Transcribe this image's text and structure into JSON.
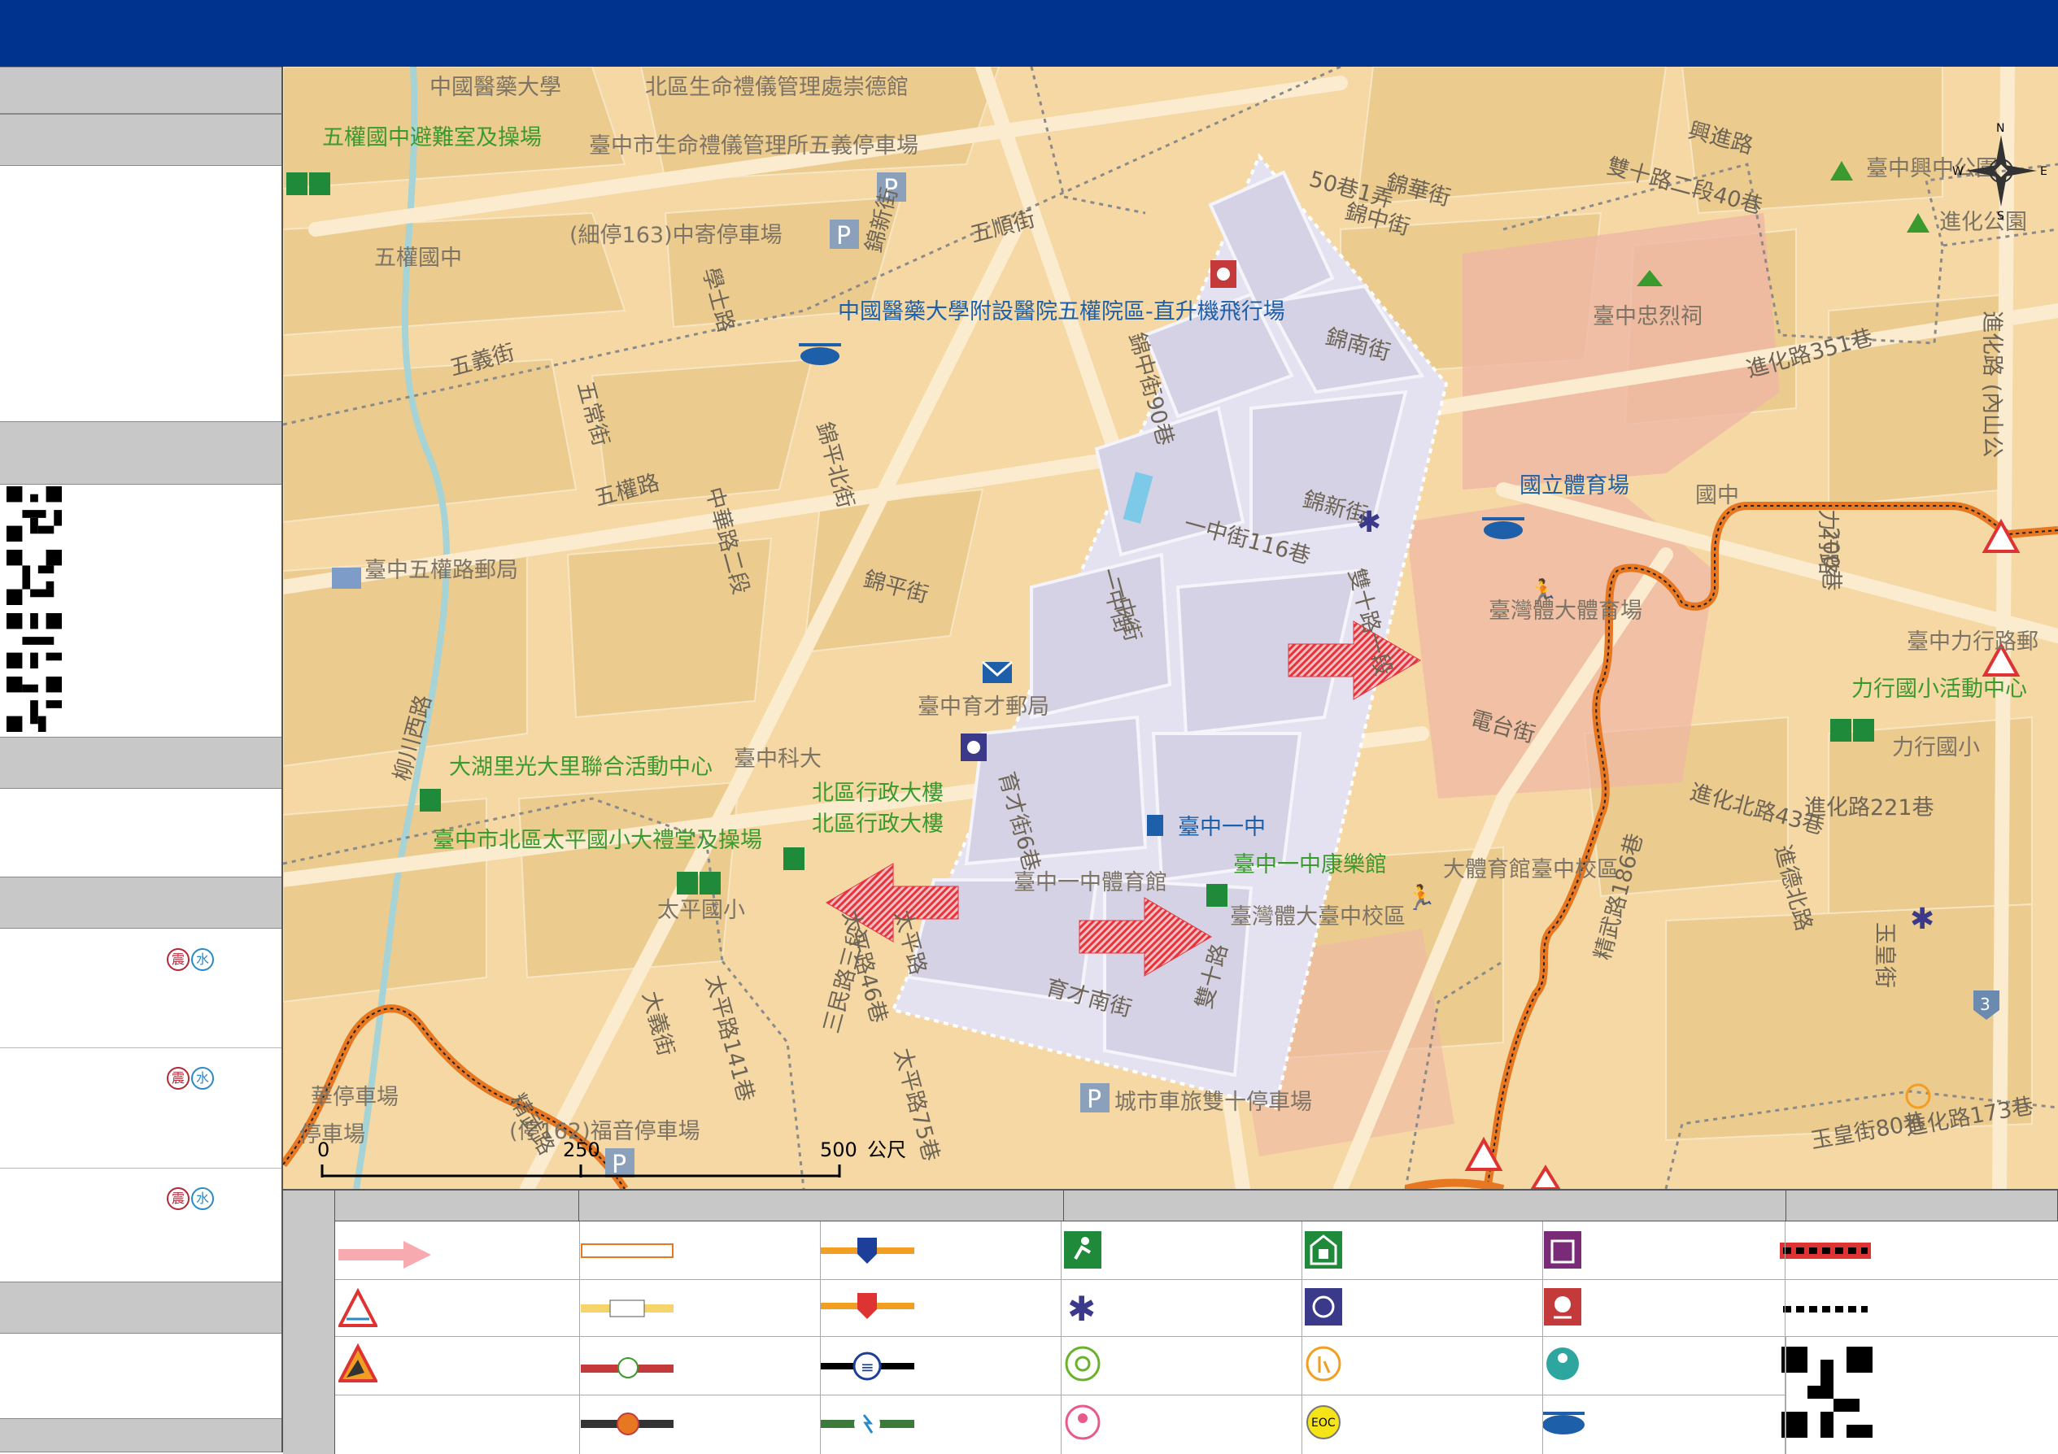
{
  "map": {
    "place_labels": [
      {
        "text": "中國醫藥大學",
        "color": "#7d7466"
      },
      {
        "text": "北區生命禮儀管理處崇德館",
        "color": "#7d7466"
      },
      {
        "text": "五權國中避難室及操場",
        "color": "#3b9a2e"
      },
      {
        "text": "臺中市生命禮儀管理所五義停車場",
        "color": "#7d7466"
      },
      {
        "text": "五權國中",
        "color": "#7d7466"
      },
      {
        "text": "(細停163)中寄停車場",
        "color": "#7d7466"
      },
      {
        "text": "中國醫藥大學附設醫院五權院區-直升機飛行場",
        "color": "#1d5fa8"
      },
      {
        "text": "臺中忠烈祠",
        "color": "#7d7466"
      },
      {
        "text": "國立體育場",
        "color": "#1d5fa8"
      },
      {
        "text": "臺中五權路郵局",
        "color": "#7d7466"
      },
      {
        "text": "臺灣體大體育場",
        "color": "#7d7466"
      },
      {
        "text": "臺中育才郵局",
        "color": "#7d7466"
      },
      {
        "text": "臺中科大",
        "color": "#7d7466"
      },
      {
        "text": "大湖里光大里聯合活動中心",
        "color": "#3b9a2e"
      },
      {
        "text": "北區行政大樓",
        "color": "#3b9a2e"
      },
      {
        "text": "北區行政大樓",
        "color": "#3b9a2e"
      },
      {
        "text": "臺中市北區太平國小大禮堂及操場",
        "color": "#3b9a2e"
      },
      {
        "text": "太平國小",
        "color": "#7d7466"
      },
      {
        "text": "臺中一中",
        "color": "#1d5fa8"
      },
      {
        "text": "臺中一中體育館",
        "color": "#7d7466"
      },
      {
        "text": "臺中一中康樂館",
        "color": "#3b9a2e"
      },
      {
        "text": "大體育館臺中校區",
        "color": "#7d7466"
      },
      {
        "text": "臺灣體大臺中校區",
        "color": "#7d7466"
      },
      {
        "text": "力行國小活動中心",
        "color": "#3b9a2e"
      },
      {
        "text": "力行國小",
        "color": "#7d7466"
      },
      {
        "text": "臺中興中公園",
        "color": "#7d7466"
      },
      {
        "text": "進化公園",
        "color": "#7d7466"
      },
      {
        "text": "城市車旅雙十停車場",
        "color": "#7d7466"
      },
      {
        "text": "華停車場",
        "color": "#7d7466"
      },
      {
        "text": "(停162)福音停車場",
        "color": "#7d7466"
      },
      {
        "text": "停車場",
        "color": "#7d7466"
      },
      {
        "text": "臺中力行路郵",
        "color": "#7d7466"
      },
      {
        "text": "國中",
        "color": "#7d7466"
      }
    ],
    "street_labels": [
      "錦華街",
      "錦中街",
      "興進路",
      "雙十路二段40巷",
      "50巷1弄",
      "五順街",
      "錦新街",
      "學士路",
      "五義街",
      "五常街",
      "五權路",
      "錦南街",
      "錦新街",
      "一中街116巷",
      "一中街",
      "錦平北街",
      "中華路二段",
      "錦平街",
      "育才街6巷",
      "雙十路一段",
      "電台街",
      "進化北路43巷",
      "進化路221巷",
      "進德北路",
      "玉皇街",
      "進化路351巷",
      "力行路",
      "進化路173巷",
      "玉皇街80巷",
      "精武路186巷",
      "太平路",
      "太平路75巷",
      "三民路三段",
      "育才南街",
      "大義街",
      "太平路141巷",
      "精武路",
      "柳川西路",
      "雙十路",
      "進化路 (內山公",
      "200巷",
      "錦中街90巷",
      "太平路46巷",
      "一中街"
    ],
    "scale": {
      "tick0": "0",
      "tick1": "250",
      "tick2": "500",
      "unit": "公尺"
    },
    "compass": {
      "n": "N",
      "s": "S",
      "e": "E",
      "w": "W"
    },
    "route_sign": "3"
  },
  "legend": {
    "eoc_label": "EOC",
    "train_symbol": "≡"
  },
  "sidebar": {
    "badge_quake": "震",
    "badge_water": "水"
  },
  "colors": {
    "header_bar": "#00338d",
    "map_base": "#f5d8a3",
    "evacuation_zone": "#e4e2f0",
    "boundary_orange": "#e87722",
    "arrow_red": "#e8323c",
    "section_gray": "#c8c8c8"
  }
}
